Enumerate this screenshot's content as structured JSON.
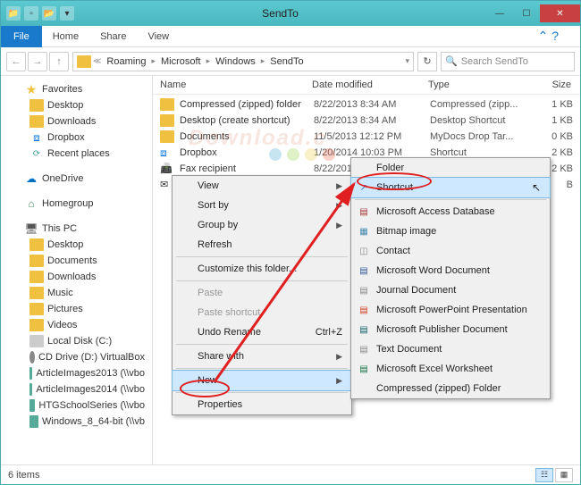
{
  "window": {
    "title": "SendTo"
  },
  "ribbon": {
    "file": "File",
    "home": "Home",
    "share": "Share",
    "view": "View"
  },
  "breadcrumb": {
    "items": [
      "Roaming",
      "Microsoft",
      "Windows",
      "SendTo"
    ]
  },
  "search": {
    "placeholder": "Search SendTo"
  },
  "sidebar": {
    "favorites": {
      "label": "Favorites",
      "items": [
        "Desktop",
        "Downloads",
        "Dropbox",
        "Recent places"
      ]
    },
    "onedrive": "OneDrive",
    "homegroup": "Homegroup",
    "thispc": {
      "label": "This PC",
      "items": [
        "Desktop",
        "Documents",
        "Downloads",
        "Music",
        "Pictures",
        "Videos",
        "Local Disk (C:)",
        "CD Drive (D:) VirtualBox",
        "ArticleImages2013 (\\\\vbo",
        "ArticleImages2014 (\\\\vbo",
        "HTGSchoolSeries (\\\\vbo",
        "Windows_8_64-bit (\\\\vb"
      ]
    }
  },
  "columns": {
    "name": "Name",
    "date": "Date modified",
    "type": "Type",
    "size": "Size"
  },
  "files": [
    {
      "name": "Compressed (zipped) folder",
      "date": "8/22/2013 8:34 AM",
      "type": "Compressed (zipp...",
      "size": "1 KB",
      "ico": "folder"
    },
    {
      "name": "Desktop (create shortcut)",
      "date": "8/22/2013 8:34 AM",
      "type": "Desktop Shortcut",
      "size": "1 KB",
      "ico": "folder"
    },
    {
      "name": "Documents",
      "date": "11/5/2013 12:12 PM",
      "type": "MyDocs Drop Tar...",
      "size": "0 KB",
      "ico": "folder"
    },
    {
      "name": "Dropbox",
      "date": "1/20/2014 10:03 PM",
      "type": "Shortcut",
      "size": "2 KB",
      "ico": "dropbox"
    },
    {
      "name": "Fax recipient",
      "date": "8/22/2013 12:00 AM",
      "type": "Shortcut",
      "size": "2 KB",
      "ico": "fax"
    },
    {
      "name": "Mail recipient",
      "date": "8/22/20",
      "type": "",
      "size": "B",
      "ico": "mail"
    }
  ],
  "ctx1": {
    "view": "View",
    "sortby": "Sort by",
    "groupby": "Group by",
    "refresh": "Refresh",
    "customize": "Customize this folder...",
    "paste": "Paste",
    "pasteshortcut": "Paste shortcut",
    "undo": "Undo Rename",
    "undo_key": "Ctrl+Z",
    "sharewith": "Share with",
    "new": "New",
    "properties": "Properties"
  },
  "ctx2": {
    "folder": "Folder",
    "shortcut": "Shortcut",
    "access": "Microsoft Access Database",
    "bitmap": "Bitmap image",
    "contact": "Contact",
    "word": "Microsoft Word Document",
    "journal": "Journal Document",
    "ppt": "Microsoft PowerPoint Presentation",
    "publisher": "Microsoft Publisher Document",
    "text": "Text Document",
    "excel": "Microsoft Excel Worksheet",
    "zip": "Compressed (zipped) Folder"
  },
  "status": {
    "count": "6 items"
  }
}
